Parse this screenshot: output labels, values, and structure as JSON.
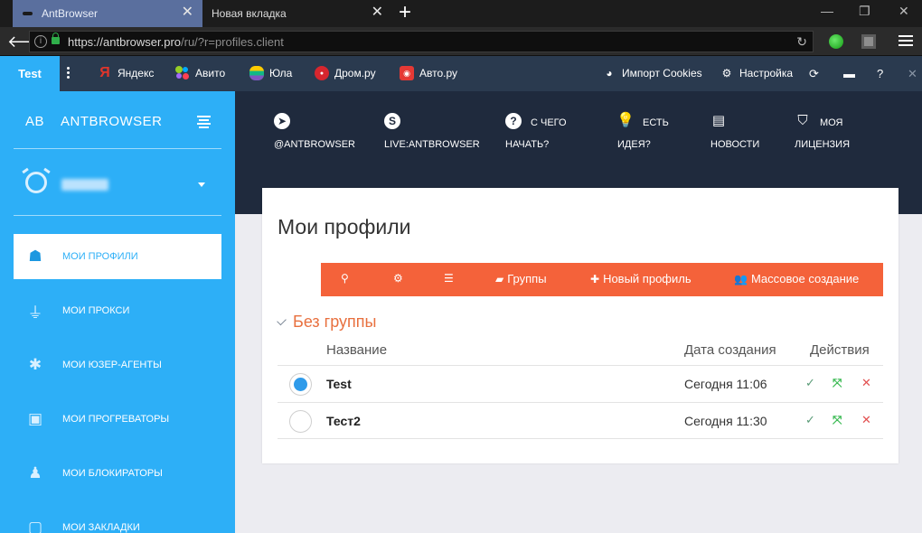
{
  "browser": {
    "tabs": [
      {
        "title": "AntBrowser",
        "active": true
      },
      {
        "title": "Новая вкладка",
        "active": false
      }
    ],
    "url_host": "https://antbrowser.pro",
    "url_path": "/ru/?r=profiles.client"
  },
  "bookmarks": {
    "profile_label": "Test",
    "items": [
      {
        "label": "Яндекс",
        "icon": "yandex-icon"
      },
      {
        "label": "Авито",
        "icon": "avito-icon"
      },
      {
        "label": "Юла",
        "icon": "youla-icon"
      },
      {
        "label": "Дром.ру",
        "icon": "drom-icon"
      },
      {
        "label": "Авто.ру",
        "icon": "autoru-icon"
      }
    ],
    "import_cookies": "Импорт Cookies",
    "settings": "Настройка"
  },
  "sidebar": {
    "logo_short": "AB",
    "brand": "ANTBROWSER",
    "items": [
      {
        "label": "МОИ ПРОФИЛИ",
        "icon": "spy-icon",
        "active": true
      },
      {
        "label": "МОИ ПРОКСИ",
        "icon": "plug-icon",
        "active": false
      },
      {
        "label": "МОИ ЮЗЕР-АГЕНТЫ",
        "icon": "bug-icon",
        "active": false
      },
      {
        "label": "МОИ ПРОГРЕВАТОРЫ",
        "icon": "robot-icon",
        "active": false
      },
      {
        "label": "МОИ БЛОКИРАТОРЫ",
        "icon": "user-lock-icon",
        "active": false
      },
      {
        "label": "МОИ ЗАКЛАДКИ",
        "icon": "bookmark-icon",
        "active": false
      }
    ]
  },
  "header_nav": [
    {
      "line1": "",
      "line2": "@ANTBROWSER",
      "icon": "telegram-icon"
    },
    {
      "line1": "",
      "line2": "LIVE:ANTBROWSER",
      "icon": "skype-icon"
    },
    {
      "line1": "С ЧЕГО",
      "line2": "НАЧАТЬ?",
      "icon": "question-icon"
    },
    {
      "line1": "ЕСТЬ",
      "line2": "ИДЕЯ?",
      "icon": "lightbulb-icon"
    },
    {
      "line1": "",
      "line2": "НОВОСТИ",
      "icon": "newspaper-icon"
    },
    {
      "line1": "МОЯ",
      "line2": "ЛИЦЕНЗИЯ",
      "icon": "shield-icon"
    }
  ],
  "main": {
    "title": "Мои профили",
    "toolbar": {
      "groups": "Группы",
      "new_profile": "Новый профиль",
      "bulk_create": "Массовое создание"
    },
    "group_name": "Без группы",
    "columns": {
      "name": "Название",
      "created": "Дата создания",
      "actions": "Действия"
    },
    "rows": [
      {
        "name": "Test",
        "created": "Сегодня 11:06",
        "selected": true
      },
      {
        "name": "Тест2",
        "created": "Сегодня 11:30",
        "selected": false
      }
    ]
  },
  "colors": {
    "sidebar": "#2daff7",
    "header": "#1f2a3d",
    "toolbar": "#f4623a",
    "group": "#e8703f"
  }
}
